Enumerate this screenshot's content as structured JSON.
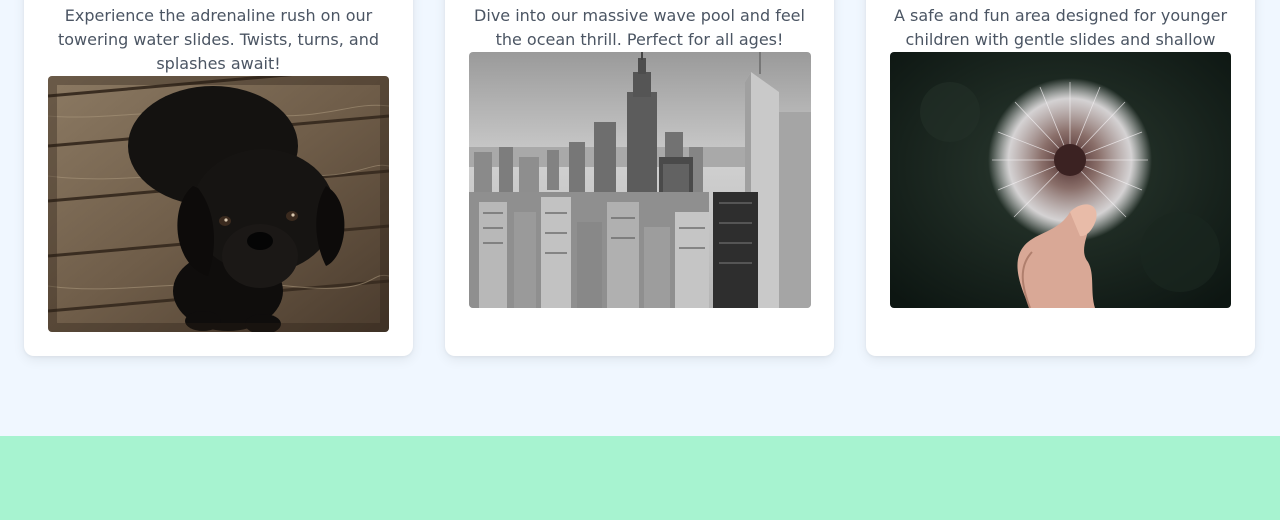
{
  "cards": [
    {
      "description": "Experience the adrenaline rush on our towering water slides. Twists, turns, and splashes await!",
      "image_icon": "black-puppy-on-wooden-floor-photo"
    },
    {
      "description": "Dive into our massive wave pool and feel the ocean thrill. Perfect for all ages!",
      "image_icon": "city-skyline-photo"
    },
    {
      "description": "A safe and fun area designed for younger children with gentle slides and shallow pools.",
      "image_icon": "dandelion-in-hand-photo"
    }
  ],
  "colors": {
    "page_background": "#f0f7ff",
    "card_background": "#ffffff",
    "description_text": "#4b5563",
    "footer_band": "#a7f3d0"
  }
}
